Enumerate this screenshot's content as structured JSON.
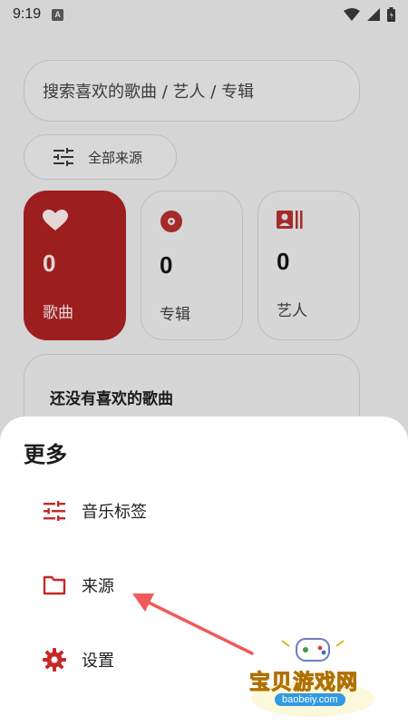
{
  "status_bar": {
    "time": "9:19",
    "notification_badge": "A"
  },
  "search": {
    "placeholder": "搜索喜欢的歌曲 / 艺人 / 专辑"
  },
  "source_filter": {
    "label": "全部来源"
  },
  "stats": [
    {
      "label": "歌曲",
      "count": "0",
      "icon": "heart-icon",
      "active": true
    },
    {
      "label": "专辑",
      "count": "0",
      "icon": "disc-icon",
      "active": false
    },
    {
      "label": "艺人",
      "count": "0",
      "icon": "artist-icon",
      "active": false
    }
  ],
  "empty_state": {
    "title": "还没有喜欢的歌曲"
  },
  "sheet": {
    "title": "更多",
    "items": [
      {
        "label": "音乐标签",
        "icon": "tune-icon"
      },
      {
        "label": "来源",
        "icon": "folder-icon"
      },
      {
        "label": "设置",
        "icon": "gear-icon"
      }
    ]
  },
  "watermark": {
    "name": "宝贝游戏网",
    "url": "baobeiy.com"
  },
  "colors": {
    "accent": "#c62828",
    "active_card": "#9c1e1e",
    "arrow": "#f05a5a"
  }
}
